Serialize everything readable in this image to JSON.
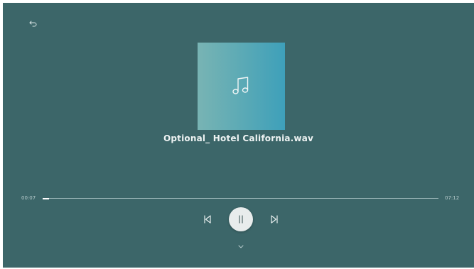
{
  "player": {
    "title": "Optional_ Hotel California.wav",
    "elapsed": "00:07",
    "total": "07:12",
    "progress_fraction": 0.017
  },
  "icons": {
    "back": "back-arrow-icon",
    "art": "music-note-icon",
    "previous": "skip-previous-icon",
    "play_pause": "pause-icon",
    "next": "skip-next-icon",
    "collapse": "chevron-down-icon"
  },
  "colors": {
    "background": "#3c6669",
    "art_gradient_start": "#78b4b4",
    "art_gradient_end": "#3ea0ba",
    "progress_track": "#9ab6b8",
    "progress_fill": "#ffffff"
  }
}
